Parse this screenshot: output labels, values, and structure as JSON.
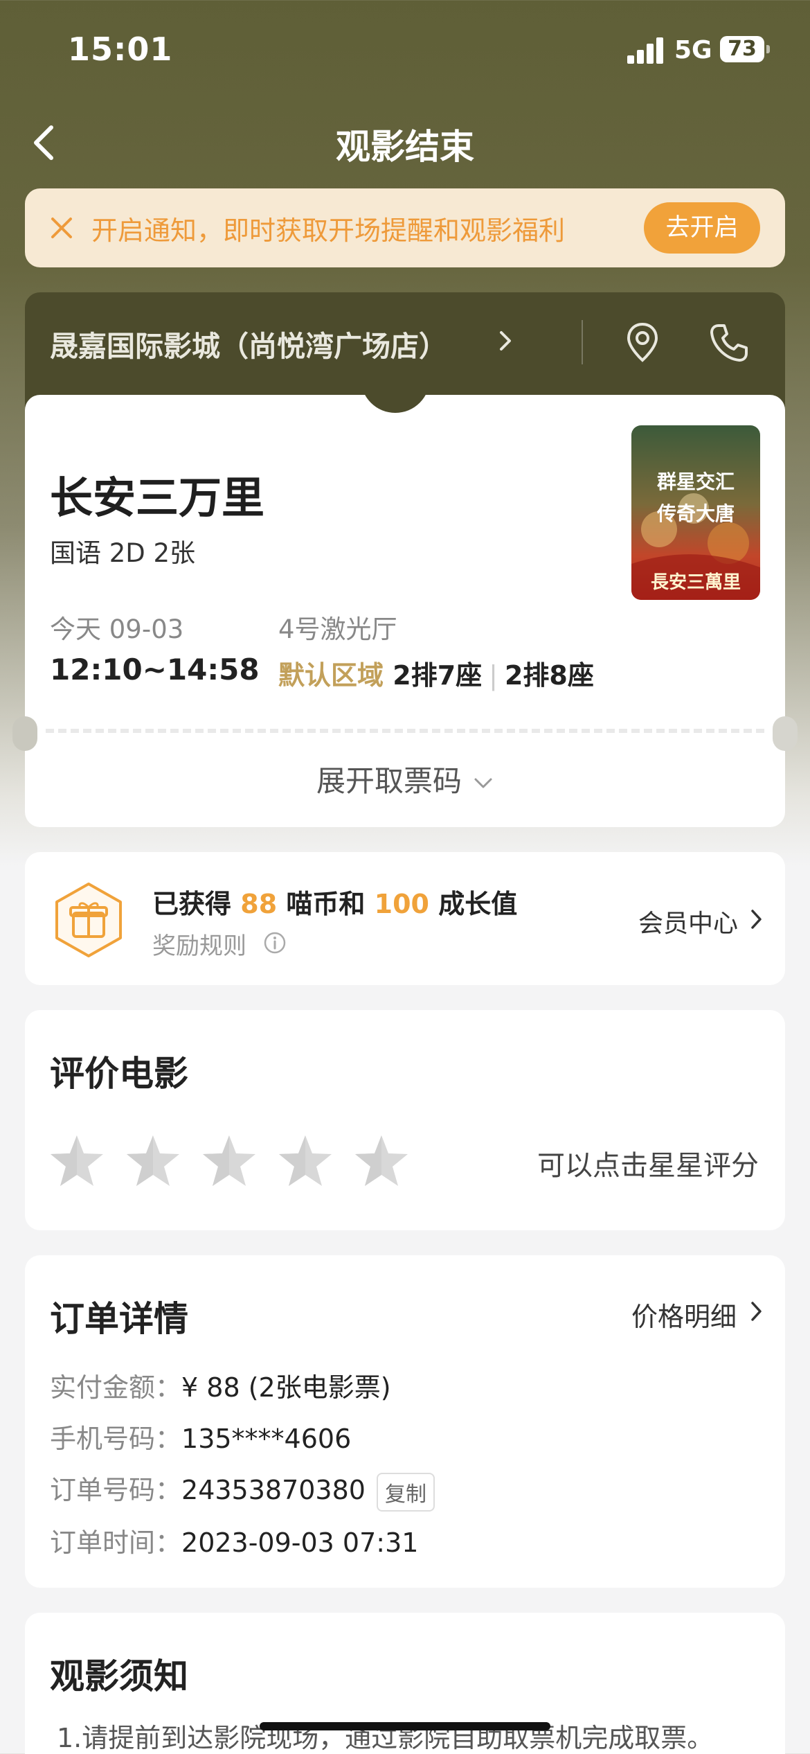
{
  "status_bar": {
    "time": "15:01",
    "network": "5G",
    "battery": "73"
  },
  "nav": {
    "title": "观影结束"
  },
  "notice": {
    "text": "开启通知，即时获取开场提醒和观影福利",
    "button": "去开启"
  },
  "cinema": {
    "name": "晟嘉国际影城（尚悦湾广场店）"
  },
  "ticket": {
    "movie_title": "长安三万里",
    "language_format": "国语 2D 2张",
    "date": "今天 09-03",
    "time_range": "12:10~14:58",
    "hall": "4号激光厅",
    "zone": "默认区域",
    "seat1": "2排7座",
    "seat2": "2排8座",
    "expand_label": "展开取票码",
    "poster_text_1": "群星交汇",
    "poster_text_2": "传奇大唐",
    "poster_logo": "長安三萬里"
  },
  "reward": {
    "prefix": "已获得",
    "coins": "88",
    "coins_unit": "喵币和",
    "growth": "100",
    "growth_unit": "成长值",
    "rule_label": "奖励规则",
    "member_link": "会员中心"
  },
  "rating": {
    "title": "评价电影",
    "hint": "可以点击星星评分",
    "max_stars": 5,
    "current": 0
  },
  "order": {
    "title": "订单详情",
    "price_link": "价格明细",
    "paid_label": "实付金额：",
    "paid_value": "¥ 88 (2张电影票)",
    "phone_label": "手机号码：",
    "phone_value": "135****4606",
    "order_no_label": "订单号码：",
    "order_no_value": "24353870380",
    "copy_label": "复制",
    "order_time_label": "订单时间：",
    "order_time_value": "2023-09-03 07:31"
  },
  "rules": {
    "title": "观影须知",
    "item1": "1.请提前到达影院现场，通过影院自助取票机完成取票。"
  },
  "colors": {
    "accent": "#f0a23a",
    "header_dark": "#4c4b2c",
    "zone_gold": "#c2a05a",
    "notice_bg": "#f7e9d3"
  }
}
